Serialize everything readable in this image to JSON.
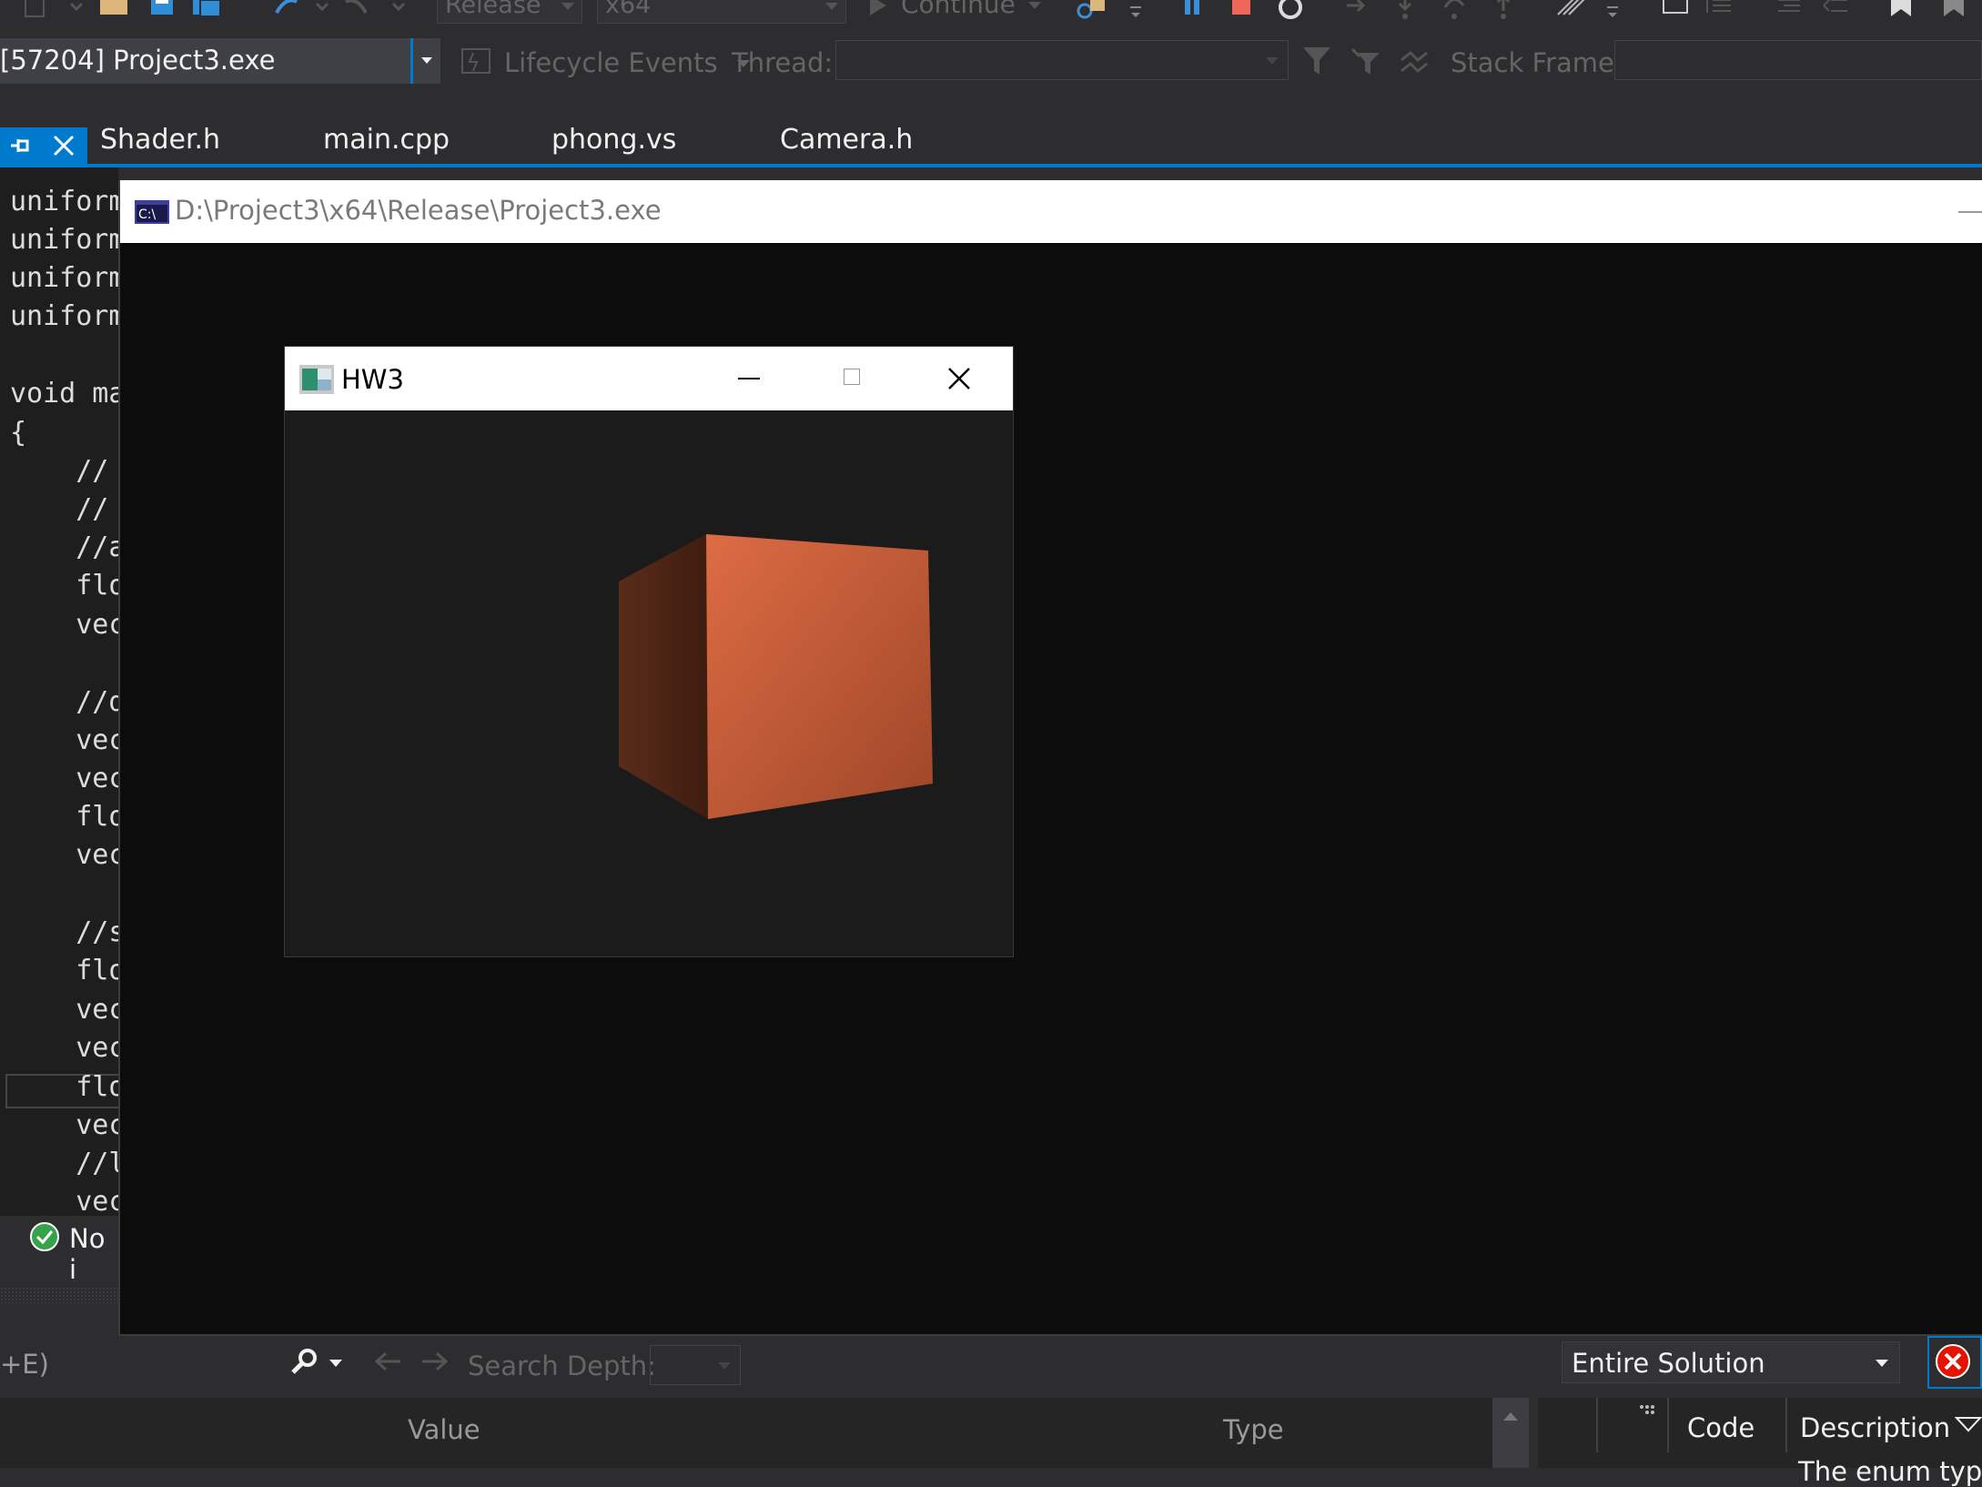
{
  "toolbar": {
    "configuration": "Release",
    "platform": "x64",
    "continue_label": "Continue"
  },
  "debug_bar": {
    "process": "[57204] Project3.exe",
    "lifecycle_events": "Lifecycle Events",
    "thread_label": "Thread:",
    "stack_frame_label": "Stack Frame:"
  },
  "tabs": [
    {
      "label": "Shader.h"
    },
    {
      "label": "main.cpp"
    },
    {
      "label": "phong.vs"
    },
    {
      "label": "Camera.h"
    }
  ],
  "code_lines": [
    "uniform",
    "uniform",
    "uniform",
    "uniform",
    "",
    "void ma",
    "{",
    "    //",
    "    //",
    "    //a",
    "    flo",
    "    vec",
    "",
    "    //d",
    "    vec",
    "    vec",
    "    flo",
    "    vec",
    "",
    "    //s",
    "    flo",
    "    vec",
    "    vec",
    "    flo",
    "    vec",
    "    //l",
    "    vec"
  ],
  "status": {
    "text": "No i"
  },
  "console": {
    "title": "D:\\Project3\\x64\\Release\\Project3.exe"
  },
  "app_window": {
    "title": "HW3",
    "cube_color": "#c65a34"
  },
  "bottom_left": {
    "search_hint": "+E)",
    "search_depth_label": "Search Depth:",
    "col_value": "Value",
    "col_type": "Type"
  },
  "bottom_right": {
    "scope": "Entire Solution",
    "col_code": "Code",
    "col_description": "Description",
    "row_text": "The enum type"
  },
  "colors": {
    "accent": "#007acc",
    "error": "#e51400",
    "success": "#37a24c"
  }
}
